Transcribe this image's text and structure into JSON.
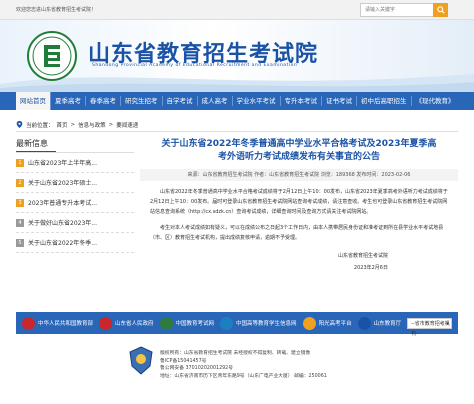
{
  "topbar": {
    "welcome": "欢迎您志进山东省教育招生考试院！",
    "search_placeholder": "请输入关键字"
  },
  "header": {
    "title_cn": "山东省教育招生考试院",
    "title_en": "Shandong Provincial Academy of Educational Recruitment and Examination"
  },
  "nav": [
    "网站首页",
    "夏季高考",
    "春季高考",
    "研究生招考",
    "自学考试",
    "成人高考",
    "学业水平考试",
    "专升本考试",
    "证书考试",
    "初中后高职招生",
    "《现代教育》"
  ],
  "breadcrumb": {
    "prefix": "当前位置：",
    "items": [
      "首页",
      "信息与政策",
      "要闻速递"
    ],
    "sep": ">"
  },
  "sidebar": {
    "title": "最新信息",
    "items": [
      {
        "num": "1",
        "text": "山东省2023年上半年高..."
      },
      {
        "num": "2",
        "text": "关于山东省2023年硕士..."
      },
      {
        "num": "3",
        "text": "2023年普通专升本考试..."
      },
      {
        "num": "4",
        "text": "关于做好山东省2023年..."
      },
      {
        "num": "5",
        "text": "关于山东省2022年冬季..."
      }
    ]
  },
  "article": {
    "title_line1": "关于山东省2022年冬季普通高中学业水平合格考试及2023年夏季高",
    "title_line2": "考外语听力考试成绩发布有关事宜的公告",
    "meta": "来源：山东省教育招生考试院 作者：山东省教育招生考试院 浏览：189368 发布时间：2023-02-06",
    "paragraphs": [
      "山东省2022年冬季普通高中学业水平合格考试成绩将于2月12日上午10：00发布，山东省2023年夏季高考外语听力考试成绩将于2月12日上午10：00发布。届时可登录山东省教育招生考试院网站查询考试成绩，请注意查收。考生也可登录山东省教育招生考试院网站信息查询系统（http://cx.sdzk.cn）查询考试成绩，详细查询时间及查询方式请关注考试院网站。",
      "考生对本人考试成绩如有疑义，可以在成绩公布之日起3个工作日内，由本人携带居民身份证和准考证到所在县学业水平考试地县（市、区）教育招生考试机构，提出成绩复核申请，逾期不予受理。"
    ],
    "signature": "山东省教育招生考试院",
    "date": "2023年2月6日"
  },
  "links": [
    {
      "label": "中华人民共和国教育部",
      "color": "#c8272d"
    },
    {
      "label": "山东省人民政府",
      "color": "#c8272d"
    },
    {
      "label": "中国教育考试网",
      "color": "#2f7a3d"
    },
    {
      "label": "中国高等教育学生信息网",
      "color": "#1c7fc2"
    },
    {
      "label": "阳光高考平台",
      "color": "#f0a020"
    },
    {
      "label": "山东教育厅",
      "color": "#1a53a6"
    }
  ],
  "region_select": "--省市教育招考机构--",
  "footer": {
    "lines": [
      "版权所有：山东省教育招生考试院 未经授权不得复制、转载、建立镜像",
      "鲁ICP备15041457号",
      "鲁公网安备 37010202001292号",
      "地址：山东省济南市历下区青年东路9号（山东广电产业大厦） 邮编：250061"
    ]
  },
  "colors": {
    "primary": "#2a66b8",
    "accent": "#f0a020"
  }
}
